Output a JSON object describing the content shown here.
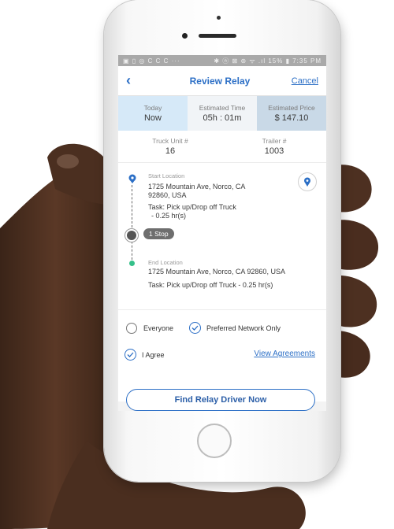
{
  "status_bar": {
    "left_icons": "▣ ▯ ◎ C C C ···",
    "right": "✱ ⓝ ⊠ ⊛ ᯤ .ıl 15% ▮ 7:35 PM"
  },
  "nav": {
    "title": "Review Relay",
    "cancel_label": "Cancel",
    "back_symbol": "‹"
  },
  "summary": [
    {
      "label": "Today",
      "value": "Now"
    },
    {
      "label": "Estimated Time",
      "value": "05h : 01m"
    },
    {
      "label": "Estimated Price",
      "value": "$ 147.10"
    }
  ],
  "units": [
    {
      "label": "Truck Unit #",
      "value": "16"
    },
    {
      "label": "Trailer #",
      "value": "1003"
    }
  ],
  "route": {
    "start": {
      "label": "Start Location",
      "address_line1": "1725 Mountain Ave, Norco, CA",
      "address_line2": "92860, USA",
      "task_line1": "Task: Pick up/Drop off Truck",
      "task_line2": "- 0.25 hr(s)"
    },
    "stops_label": "1 Stop",
    "end": {
      "label": "End Location",
      "address": "1725 Mountain Ave, Norco, CA 92860, USA",
      "task": "Task: Pick up/Drop off Truck -  0.25 hr(s)"
    }
  },
  "options": {
    "everyone_label": "Everyone",
    "preferred_label": "Preferred Network Only",
    "agree_label": "I Agree",
    "view_agreements_label": "View Agreements"
  },
  "actions": {
    "find_driver_label": "Find Relay Driver Now"
  },
  "colors": {
    "accent": "#2c6fc6",
    "today_bg": "#d6e9f8",
    "price_bg": "#c9d9e7",
    "end_dot": "#35c08a"
  }
}
